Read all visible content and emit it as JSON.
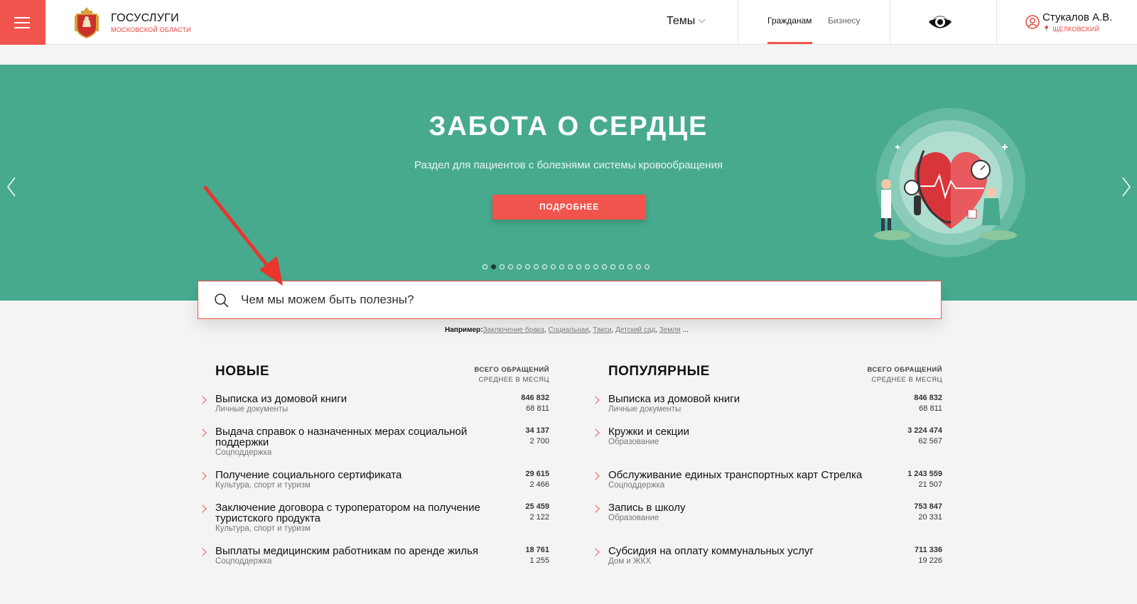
{
  "header": {
    "brand_title": "ГОСУСЛУГИ",
    "brand_sub": "МОСКОВСКОЙ ОБЛАСТИ",
    "topics_label": "Темы",
    "tabs": [
      {
        "label": "Гражданам",
        "active": true
      },
      {
        "label": "Бизнесу",
        "active": false
      }
    ],
    "user_name": "Стукалов А.В.",
    "user_location": "ЩЕЛКОВСКИЙ"
  },
  "banner": {
    "title": "ЗАБОТА О СЕРДЦЕ",
    "subtitle": "Раздел для пациентов с болезнями системы кровообращения",
    "button_label": "ПОДРОБНЕЕ",
    "slide_count": 20,
    "active_slide": 2,
    "background_color": "#47aa8e"
  },
  "search": {
    "placeholder": "Чем мы можем быть полезны?",
    "examples_label": "Например:",
    "examples": [
      "Заключение брака",
      "Социальная",
      "Такси",
      "Детский сад",
      "Земля"
    ],
    "examples_more": "..."
  },
  "lists": {
    "header_right_line1": "ВСЕГО ОБРАЩЕНИЙ",
    "header_right_line2": "СРЕДНЕЕ В МЕСЯЦ",
    "new": {
      "title": "НОВЫЕ",
      "items": [
        {
          "title": "Выписка из домовой книги",
          "category": "Личные документы",
          "total": "846 832",
          "avg": "68 811"
        },
        {
          "title": "Выдача справок о назначенных мерах социальной поддержки",
          "category": "Соцподдержка",
          "total": "34 137",
          "avg": "2 700"
        },
        {
          "title": "Получение социального сертификата",
          "category": "Культура, спорт и туризм",
          "total": "29 615",
          "avg": "2 466"
        },
        {
          "title": "Заключение договора с туроператором на получение туристского продукта",
          "category": "Культура, спорт и туризм",
          "total": "25 459",
          "avg": "2 122"
        },
        {
          "title": "Выплаты медицинским работникам по аренде жилья",
          "category": "Соцподдержка",
          "total": "18 761",
          "avg": "1 255"
        }
      ]
    },
    "popular": {
      "title": "ПОПУЛЯРНЫЕ",
      "items": [
        {
          "title": "Выписка из домовой книги",
          "category": "Личные документы",
          "total": "846 832",
          "avg": "68 811"
        },
        {
          "title": "Кружки и секции",
          "category": "Образование",
          "total": "3 224 474",
          "avg": "62 567"
        },
        {
          "title": "Обслуживание единых транспортных карт Стрелка",
          "category": "Соцподдержка",
          "total": "1 243 559",
          "avg": "21 507"
        },
        {
          "title": "Запись в школу",
          "category": "Образование",
          "total": "753 847",
          "avg": "20 331"
        },
        {
          "title": "Субсидия на оплату коммунальных услуг",
          "category": "Дом и ЖКХ",
          "total": "711 336",
          "avg": "19 226"
        }
      ]
    }
  },
  "colors": {
    "accent": "#f0544c",
    "banner": "#47aa8e"
  }
}
